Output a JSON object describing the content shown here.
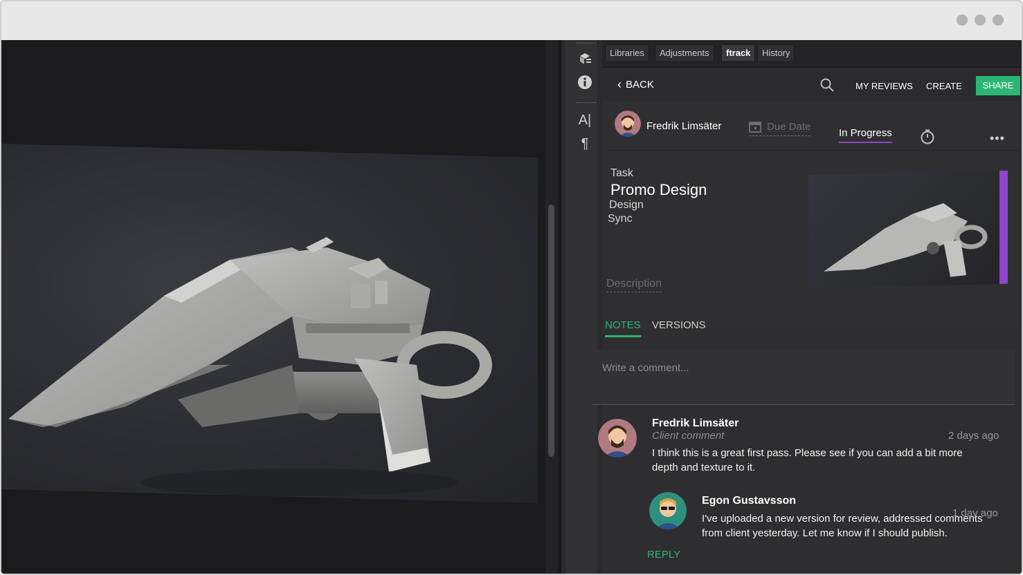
{
  "window": {
    "dots": 3
  },
  "panel_tabs": [
    "Libraries",
    "Adjustments",
    "ftrack",
    "History"
  ],
  "nav": {
    "back_label": "BACK",
    "my_reviews_label": "MY REVIEWS",
    "create_label": "CREATE",
    "share_label": "SHARE"
  },
  "taskbar": {
    "assignee": "Fredrik Limsäter",
    "due_date_label": "Due Date",
    "status": "In Progress",
    "status_color": "#8f45c9"
  },
  "task": {
    "label": "Task",
    "name": "Promo Design",
    "type": "Design",
    "project": "Sync",
    "description_placeholder": "Description"
  },
  "tabs": {
    "notes": "NOTES",
    "versions": "VERSIONS"
  },
  "comment": {
    "placeholder": "Write a comment..."
  },
  "notes": [
    {
      "author": "Fredrik Limsäter",
      "kind": "Client comment",
      "time": "2 days ago",
      "text_line1": "I think this is a great first pass. Please see if you can add a bit more",
      "text_line2": "depth and texture to it."
    },
    {
      "author": "Egon Gustavsson",
      "time": "1 day ago",
      "text_line1": "I've uploaded a new version for review, addressed comments",
      "text_line2": "from client yesterday. Let me know if I should publish."
    }
  ],
  "reply_label": "REPLY",
  "colors": {
    "accent": "#2bb673",
    "status_purple": "#8f45c9"
  }
}
